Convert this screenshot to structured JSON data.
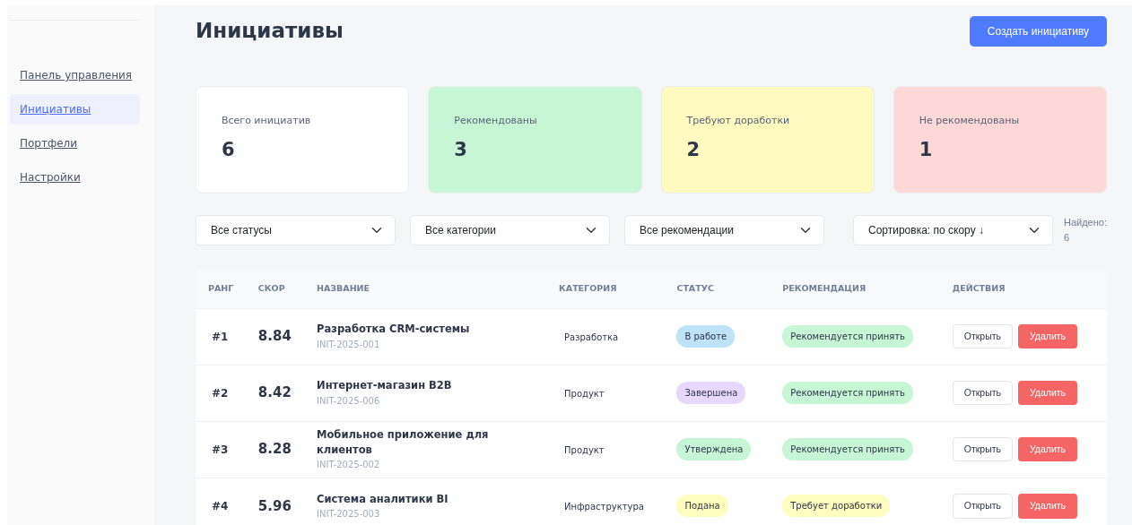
{
  "sidebar": {
    "items": [
      {
        "label": "Панель управления",
        "selected": false
      },
      {
        "label": "Инициативы",
        "selected": true
      },
      {
        "label": "Портфели",
        "selected": false
      },
      {
        "label": "Настройки",
        "selected": false
      }
    ]
  },
  "header": {
    "title": "Инициативы",
    "create_button": "Создать инициативу"
  },
  "stats": [
    {
      "label": "Всего инициатив",
      "value": "6",
      "color": "#ffffff"
    },
    {
      "label": "Рекомендованы",
      "value": "3",
      "color": "#c6f6d5"
    },
    {
      "label": "Требуют доработки",
      "value": "2",
      "color": "#fefac0"
    },
    {
      "label": "Не рекомендованы",
      "value": "1",
      "color": "#fed7d7"
    }
  ],
  "filters": [
    {
      "value": "Все статусы"
    },
    {
      "value": "Все категории"
    },
    {
      "value": "Все рекомендации"
    }
  ],
  "sort": {
    "value": "Сортировка: по скору ↓"
  },
  "found": "Найдено: 6",
  "table": {
    "columns": [
      "РАНГ",
      "СКОР",
      "НАЗВАНИЕ",
      "КАТЕГОРИЯ",
      "СТАТУС",
      "РЕКОМЕНДАЦИЯ",
      "ДЕЙСТВИЯ"
    ],
    "rows": [
      {
        "rank": "#1",
        "score": "8.84",
        "name": "Разработка CRM-системы",
        "code": "INIT-2025-001",
        "category": "Разработка",
        "status": {
          "text": "В работе",
          "color": "#bee3f8"
        },
        "recommendation": {
          "text": "Рекомендуется принять",
          "color": "#c6f6d5"
        },
        "actions": [
          "Открыть",
          "Удалить"
        ]
      },
      {
        "rank": "#2",
        "score": "8.42",
        "name": "Интернет-магазин B2B",
        "code": "INIT-2025-006",
        "category": "Продукт",
        "status": {
          "text": "Завершена",
          "color": "#e9d8fd"
        },
        "recommendation": {
          "text": "Рекомендуется принять",
          "color": "#c6f6d5"
        },
        "actions": [
          "Открыть",
          "Удалить"
        ]
      },
      {
        "rank": "#3",
        "score": "8.28",
        "name": "Мобильное приложение для клиентов",
        "code": "INIT-2025-002",
        "category": "Продукт",
        "status": {
          "text": "Утверждена",
          "color": "#c6f6d5"
        },
        "recommendation": {
          "text": "Рекомендуется принять",
          "color": "#c6f6d5"
        },
        "actions": [
          "Открыть",
          "Удалить"
        ]
      },
      {
        "rank": "#4",
        "score": "5.96",
        "name": "Система аналитики BI",
        "code": "INIT-2025-003",
        "category": "Инфраструктура",
        "status": {
          "text": "Подана",
          "color": "#fefcbf"
        },
        "recommendation": {
          "text": "Требует доработки",
          "color": "#fefcbf"
        },
        "actions": [
          "Открыть",
          "Удалить"
        ]
      }
    ]
  }
}
